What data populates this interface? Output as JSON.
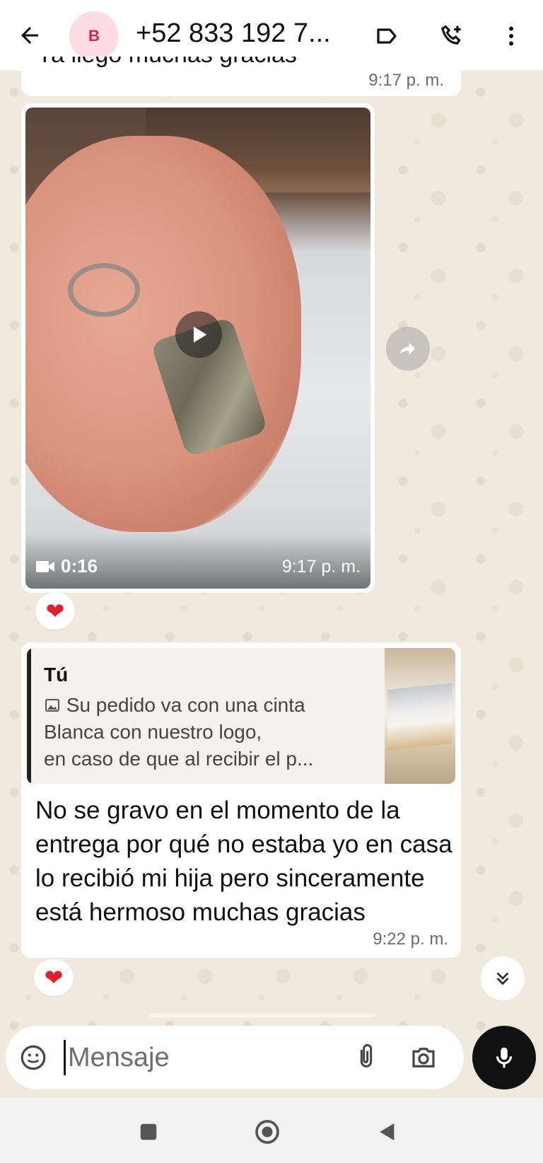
{
  "header": {
    "avatar_letter": "B",
    "contact_name": "+52 833 192 7...",
    "icons": [
      "back-arrow-icon",
      "label-tag-icon",
      "add-call-icon",
      "more-vertical-icon"
    ]
  },
  "messages": {
    "previous_text_clipped": "Ya llegó muchas gracias",
    "previous_time": "9:17 p. m.",
    "video": {
      "duration": "0:16",
      "time": "9:17 p. m.",
      "reaction": "❤"
    },
    "reply": {
      "quote_author": "Tú",
      "quote_lines": [
        "Su pedido va con una cinta",
        "Blanca con nuestro logo,",
        "en caso de que al recibir el p..."
      ],
      "text": "No se gravo en el momento de la entrega por qué no estaba yo en casa lo recibió mi hija pero sinceramente está hermoso muchas gracias",
      "time": "9:22 p. m.",
      "reaction": "❤"
    }
  },
  "composer": {
    "placeholder": "Mensaje"
  },
  "colors": {
    "chat_background": "#efe9de",
    "bubble": "#ffffff",
    "avatar_bg": "#fbdde3",
    "avatar_fg": "#d2244c",
    "reaction_heart": "#e0202f"
  }
}
